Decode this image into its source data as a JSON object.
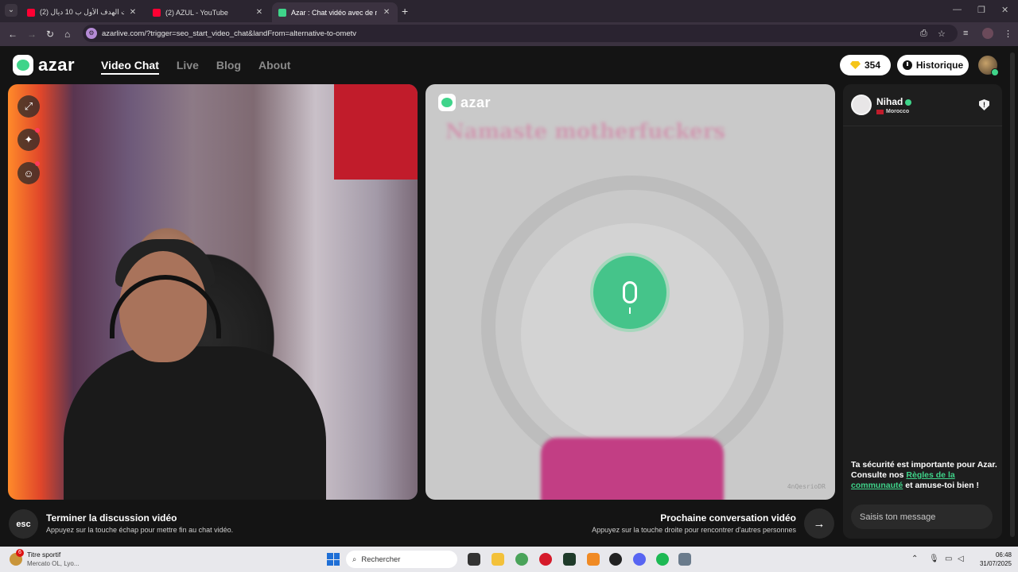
{
  "browser": {
    "tabs": [
      {
        "title": "(2) حققت الهدف الأول ب 10 ديال",
        "favicon_color": "#ff0033",
        "active": false
      },
      {
        "title": "(2) AZUL - YouTube",
        "favicon_color": "#ff0033",
        "active": false
      },
      {
        "title": "Azar : Chat vidéo avec de n",
        "favicon_color": "#3fd48a",
        "active": true
      }
    ],
    "new_tab": "+",
    "url": "azarlive.com/?trigger=seo_start_video_chat&landFrom=alternative-to-ometv"
  },
  "site": {
    "logo_text": "azar",
    "nav": [
      {
        "label": "Video Chat",
        "active": true
      },
      {
        "label": "Live",
        "active": false
      },
      {
        "label": "Blog",
        "active": false
      },
      {
        "label": "About",
        "active": false
      }
    ],
    "gems_count": "354",
    "history_label": "Historique"
  },
  "remote_video": {
    "logo_text": "azar",
    "overlay_text": "Namaste motherfuckers",
    "session_id": "4nQesrioDR",
    "mic_button": "mic-icon"
  },
  "controls": {
    "esc_key": "esc",
    "end_title": "Terminer la discussion vidéo",
    "end_subtitle": "Appuyez sur la touche échap pour mettre fin au chat vidéo.",
    "next_title": "Prochaine conversation vidéo",
    "next_subtitle": "Appuyez sur la touche droite pour rencontrer d'autres personnes",
    "next_arrow": "→"
  },
  "chat": {
    "peer_name": "Nihad",
    "peer_country": "Morocco",
    "safety_text_1": "Ta sécurité est importante pour Azar. Consulte nos ",
    "safety_link": "Règles de la communauté",
    "safety_text_2": " et amuse-toi bien !",
    "input_placeholder": "Saisis ton message"
  },
  "taskbar": {
    "news_badge": "6",
    "news_title": "Titre sportif",
    "news_subtitle": "Mercato OL, Lyo...",
    "search_placeholder": "Rechercher",
    "time": "06:48",
    "date": "31/07/2025"
  },
  "colors": {
    "accent": "#3fd48a",
    "flag_red": "#c11c2b"
  }
}
